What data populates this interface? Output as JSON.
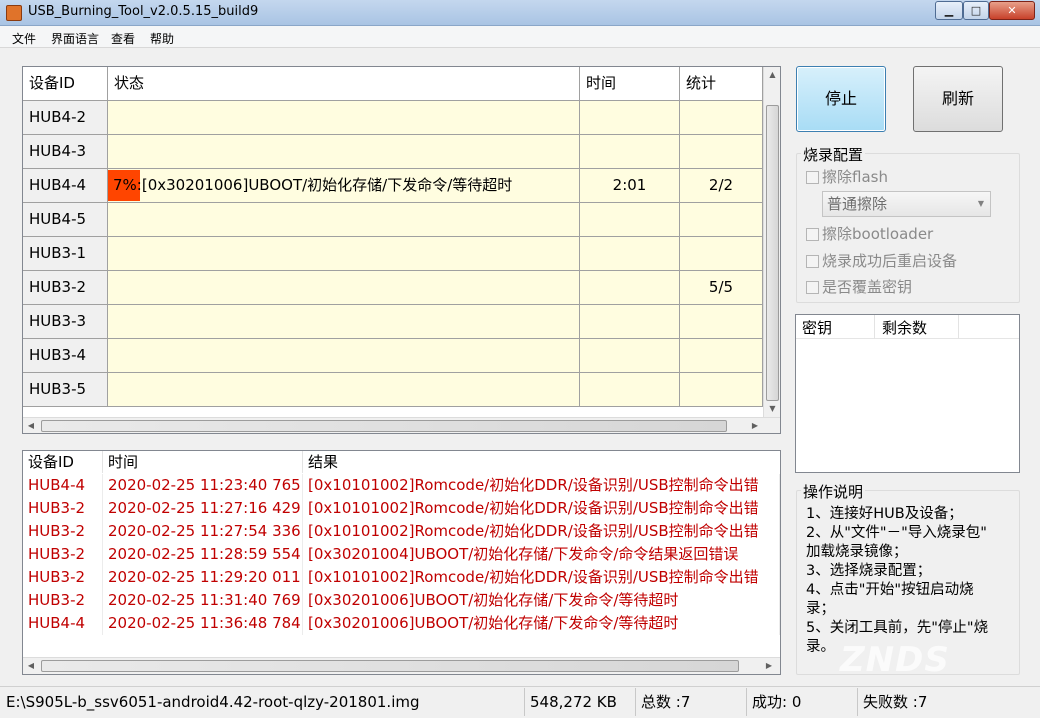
{
  "window": {
    "title": "USB_Burning_Tool_v2.0.5.15_build9",
    "controls": {
      "minimize": "▁",
      "maximize": "□",
      "close": "✕"
    }
  },
  "menu": [
    "文件",
    "界面语言",
    "查看",
    "帮助"
  ],
  "grid": {
    "columns": [
      "设备ID",
      "状态",
      "时间",
      "统计"
    ],
    "rows": [
      {
        "id": "HUB4-2",
        "progress": "",
        "status": "",
        "time": "",
        "stat": ""
      },
      {
        "id": "HUB4-3",
        "progress": "",
        "status": "",
        "time": "",
        "stat": ""
      },
      {
        "id": "HUB4-4",
        "progress": "7%",
        "status": ":[0x30201006]UBOOT/初始化存储/下发命令/等待超时",
        "time": "2:01",
        "stat": "2/2"
      },
      {
        "id": "HUB4-5",
        "progress": "",
        "status": "",
        "time": "",
        "stat": ""
      },
      {
        "id": "HUB3-1",
        "progress": "",
        "status": "",
        "time": "",
        "stat": ""
      },
      {
        "id": "HUB3-2",
        "progress": "",
        "status": "",
        "time": "",
        "stat": "5/5"
      },
      {
        "id": "HUB3-3",
        "progress": "",
        "status": "",
        "time": "",
        "stat": ""
      },
      {
        "id": "HUB3-4",
        "progress": "",
        "status": "",
        "time": "",
        "stat": ""
      },
      {
        "id": "HUB3-5",
        "progress": "",
        "status": "",
        "time": "",
        "stat": ""
      }
    ],
    "progress_fraction": 0.07
  },
  "log": {
    "columns": [
      "设备ID",
      "时间",
      "结果"
    ],
    "rows": [
      {
        "id": "HUB4-4",
        "time": "2020-02-25 11:23:40 765",
        "result": "[0x10101002]Romcode/初始化DDR/设备识别/USB控制命令出错"
      },
      {
        "id": "HUB3-2",
        "time": "2020-02-25 11:27:16 429",
        "result": "[0x10101002]Romcode/初始化DDR/设备识别/USB控制命令出错"
      },
      {
        "id": "HUB3-2",
        "time": "2020-02-25 11:27:54 336",
        "result": "[0x10101002]Romcode/初始化DDR/设备识别/USB控制命令出错"
      },
      {
        "id": "HUB3-2",
        "time": "2020-02-25 11:28:59 554",
        "result": "[0x30201004]UBOOT/初始化存储/下发命令/命令结果返回错误"
      },
      {
        "id": "HUB3-2",
        "time": "2020-02-25 11:29:20 011",
        "result": "[0x10101002]Romcode/初始化DDR/设备识别/USB控制命令出错"
      },
      {
        "id": "HUB3-2",
        "time": "2020-02-25 11:31:40 769",
        "result": "[0x30201006]UBOOT/初始化存储/下发命令/等待超时"
      },
      {
        "id": "HUB4-4",
        "time": "2020-02-25 11:36:48 784",
        "result": "[0x30201006]UBOOT/初始化存储/下发命令/等待超时"
      }
    ],
    "error_color": "#c00000"
  },
  "buttons": {
    "stop": "停止",
    "refresh": "刷新"
  },
  "config": {
    "label": "烧录配置",
    "erase_flash": "擦除flash",
    "erase_mode": "普通擦除",
    "erase_bootloader": "擦除bootloader",
    "reboot_after": "烧录成功后重启设备",
    "overwrite_key": "是否覆盖密钥"
  },
  "keys": {
    "columns": [
      "密钥",
      "剩余数"
    ]
  },
  "instructions": {
    "label": "操作说明",
    "lines": [
      "1、连接好HUB及设备；",
      "2、从\"文件\"－\"导入烧录包\"",
      "加载烧录镜像；",
      "3、选择烧录配置；",
      "4、点击\"开始\"按钮启动烧",
      "录；",
      "5、关闭工具前，先\"停止\"烧",
      "录。"
    ]
  },
  "status": {
    "path": "E:\\S905L-b_ssv6051-android4.42-root-qlzy-201801.img",
    "size": "548,272 KB",
    "total": "总数 :7",
    "success": "成功:  0",
    "fail": "失败数 :7"
  },
  "watermark": "ZNDS"
}
